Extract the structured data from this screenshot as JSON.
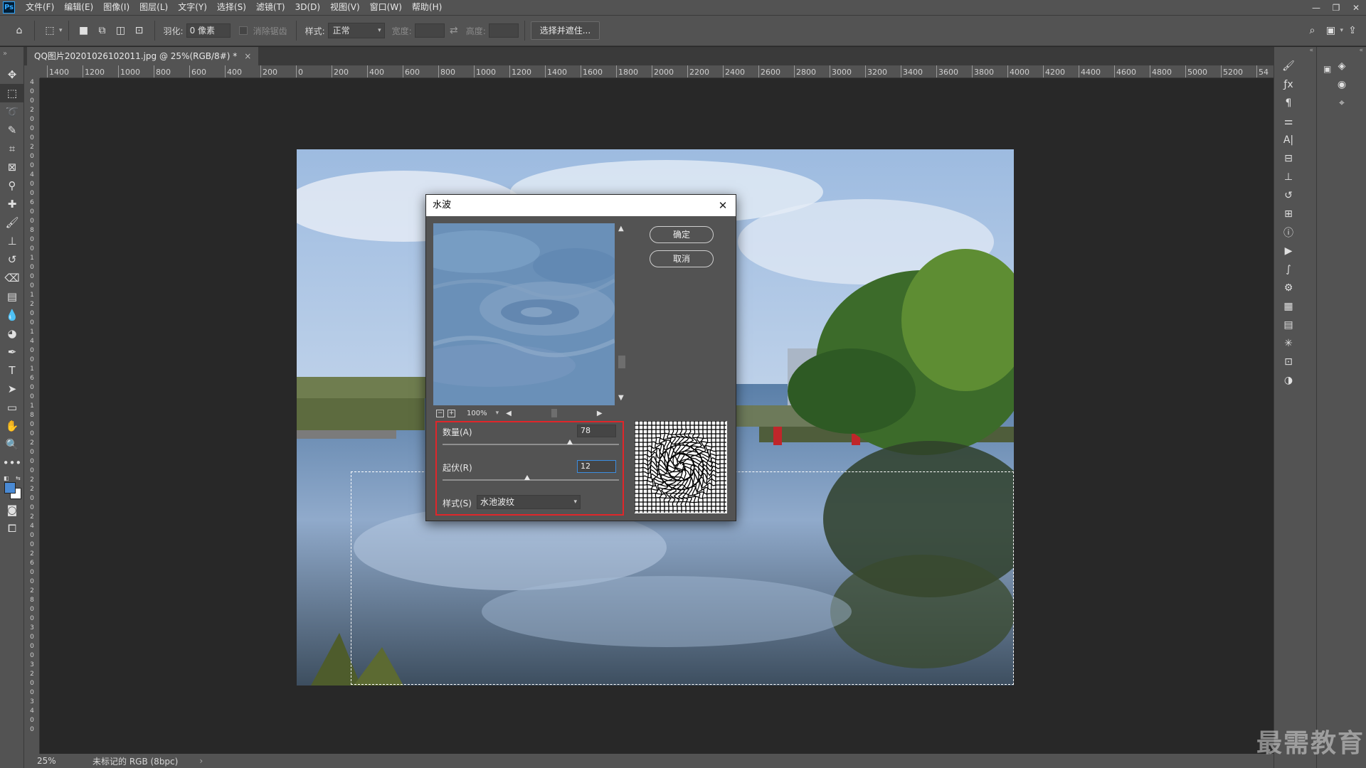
{
  "app": {
    "logo": "Ps",
    "menu": [
      "文件(F)",
      "编辑(E)",
      "图像(I)",
      "图层(L)",
      "文字(Y)",
      "选择(S)",
      "滤镜(T)",
      "3D(D)",
      "视图(V)",
      "窗口(W)",
      "帮助(H)"
    ],
    "window_controls": [
      "minimize-icon",
      "restore-icon",
      "close-icon"
    ]
  },
  "options_bar": {
    "feather_label": "羽化:",
    "feather_value": "0 像素",
    "antialias_label": "消除锯齿",
    "style_label": "样式:",
    "style_value": "正常",
    "width_label": "宽度:",
    "height_label": "高度:",
    "select_mask_button": "选择并遮住..."
  },
  "document": {
    "tab_title": "QQ图片20201026102011.jpg @ 25%(RGB/8#) *",
    "tab_close": "×"
  },
  "ruler": {
    "h_labels": [
      "1400",
      "1200",
      "1000",
      "800",
      "600",
      "400",
      "200",
      "0",
      "200",
      "400",
      "600",
      "800",
      "1000",
      "1200",
      "1400",
      "1600",
      "1800",
      "2000",
      "2200",
      "2400",
      "2600",
      "2800",
      "3000",
      "3200",
      "3400",
      "3600",
      "3800",
      "4000",
      "4200",
      "4400",
      "4600",
      "4800",
      "5000",
      "5200",
      "54"
    ],
    "v_labels": [
      "4",
      "0",
      "0",
      "2",
      "0",
      "0",
      "0",
      "2",
      "0",
      "0",
      "4",
      "0",
      "0",
      "6",
      "0",
      "0",
      "8",
      "0",
      "0",
      "1",
      "0",
      "0",
      "0",
      "1",
      "2",
      "0",
      "0",
      "1",
      "4",
      "0",
      "0",
      "1",
      "6",
      "0",
      "0",
      "1",
      "8",
      "0",
      "0",
      "2",
      "0",
      "0",
      "0",
      "2",
      "2",
      "0",
      "0",
      "2",
      "4",
      "0",
      "0",
      "2",
      "6",
      "0",
      "0",
      "2",
      "8",
      "0",
      "0",
      "3",
      "0",
      "0",
      "0",
      "3",
      "2",
      "0",
      "0",
      "3",
      "4",
      "0",
      "0"
    ]
  },
  "status": {
    "zoom": "25%",
    "profile": "未标记的 RGB (8bpc)",
    "arrow": "›"
  },
  "dialog": {
    "title": "水波",
    "close": "✕",
    "ok_label": "确定",
    "cancel_label": "取消",
    "preview_zoom": "100%",
    "amount_label": "数量(A)",
    "amount_value": "78",
    "amount_fraction": 0.72,
    "ridges_label": "起伏(R)",
    "ridges_value": "12",
    "ridges_fraction": 0.48,
    "style_label": "样式(S)",
    "style_value": "水池波纹"
  },
  "watermark": "最需教育",
  "colors": {
    "highlight_border": "#e0262a",
    "foreground_swatch": "#4a8ad4",
    "background_swatch": "#ffffff"
  }
}
